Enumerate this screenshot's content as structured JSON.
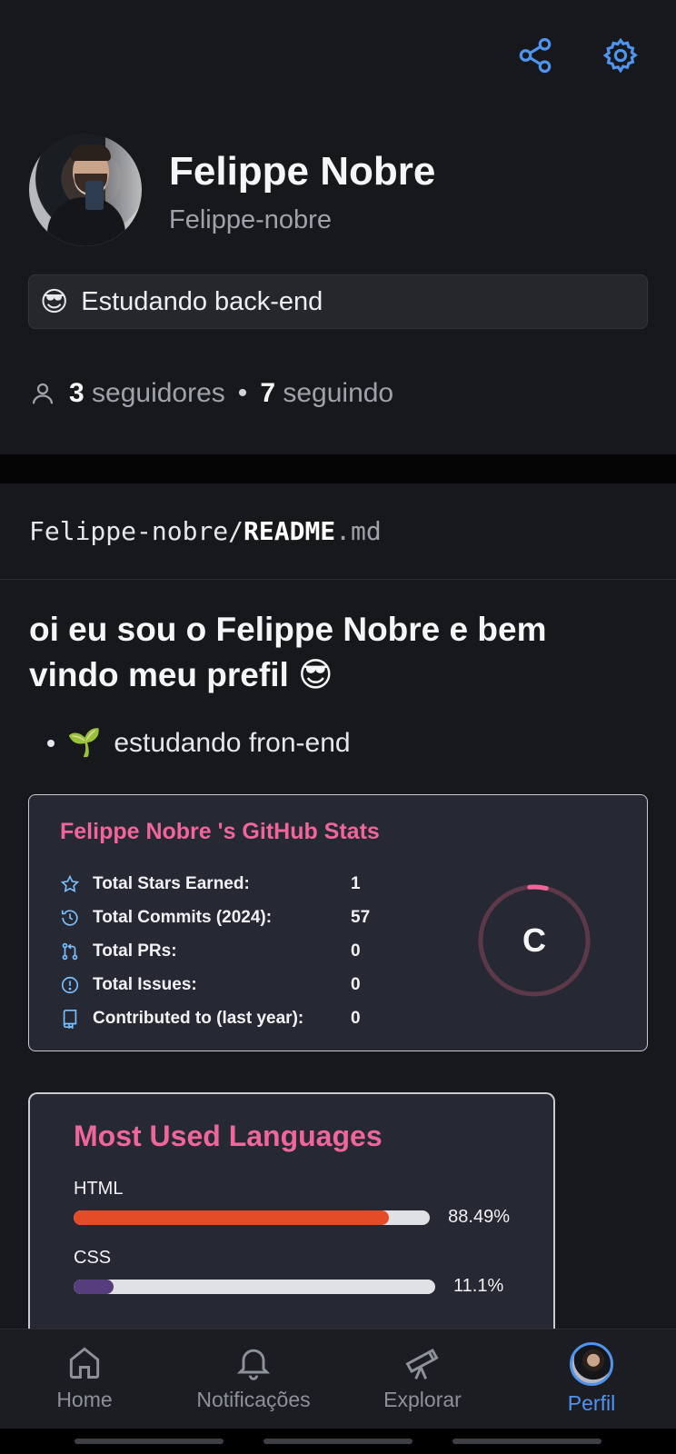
{
  "colors": {
    "accent": "#4f94ef",
    "stats_title": "#f0669a",
    "html": "#e34c26",
    "css": "#563d7c",
    "ring": "#f0669a"
  },
  "header": {
    "share_icon": "share-icon",
    "settings_icon": "gear-icon"
  },
  "profile": {
    "display_name": "Felippe Nobre",
    "username": "Felippe-nobre",
    "status_emoji": "😎",
    "status_text": "Estudando back-end",
    "followers_count": "3",
    "followers_label": "seguidores",
    "separator": "•",
    "following_count": "7",
    "following_label": "seguindo"
  },
  "readme": {
    "path_owner": "Felippe-nobre/",
    "path_file": "README",
    "path_ext": ".md",
    "title": "oi eu sou o Felippe Nobre e bem vindo meu prefil 😎",
    "bullet_emoji": "🌱",
    "bullet_text": "estudando fron-end"
  },
  "stats_card": {
    "title": "Felippe Nobre 's GitHub Stats",
    "rows": [
      {
        "icon": "star-icon",
        "label": "Total Stars Earned:",
        "value": "1"
      },
      {
        "icon": "history-icon",
        "label": "Total Commits (2024):",
        "value": "57"
      },
      {
        "icon": "pull-request-icon",
        "label": "Total PRs:",
        "value": "0"
      },
      {
        "icon": "issue-icon",
        "label": "Total Issues:",
        "value": "0"
      },
      {
        "icon": "repo-icon",
        "label": "Contributed to (last year):",
        "value": "0"
      }
    ],
    "grade": "C",
    "grade_progress": 0.05
  },
  "languages_card": {
    "title": "Most Used Languages",
    "items": [
      {
        "name": "HTML",
        "percent": 88.49,
        "label": "88.49%"
      },
      {
        "name": "CSS",
        "percent": 11.1,
        "label": "11.1%"
      }
    ]
  },
  "bottom_nav": [
    {
      "icon": "home-icon",
      "label": "Home",
      "active": false
    },
    {
      "icon": "bell-icon",
      "label": "Notificações",
      "active": false
    },
    {
      "icon": "telescope-icon",
      "label": "Explorar",
      "active": false
    },
    {
      "icon": "avatar",
      "label": "Perfil",
      "active": true
    }
  ]
}
